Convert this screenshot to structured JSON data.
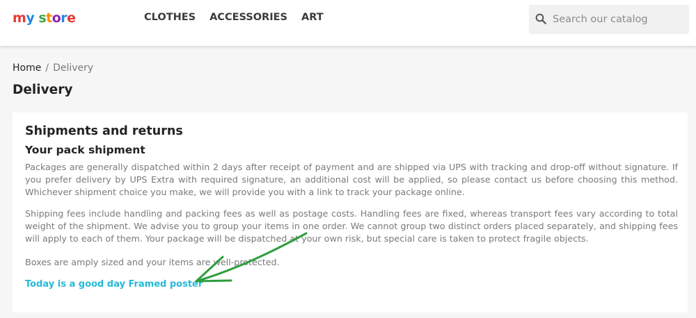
{
  "header": {
    "logo": {
      "parts": [
        {
          "text": "m",
          "color": "#e53935"
        },
        {
          "text": "y",
          "color": "#1e88e5"
        },
        {
          "text": " ",
          "color": "#000000"
        },
        {
          "text": "s",
          "color": "#43a047"
        },
        {
          "text": "t",
          "color": "#fb8c00"
        },
        {
          "text": "o",
          "color": "#8e24aa"
        },
        {
          "text": "r",
          "color": "#1e88e5"
        },
        {
          "text": "e",
          "color": "#e53935"
        }
      ],
      "full_text": "my store"
    },
    "nav": [
      "CLOTHES",
      "ACCESSORIES",
      "ART"
    ],
    "search": {
      "placeholder": "Search our catalog",
      "icon": "search-icon"
    }
  },
  "breadcrumb": {
    "home": "Home",
    "separator": "/",
    "current": "Delivery"
  },
  "page_title": "Delivery",
  "content": {
    "heading": "Shipments and returns",
    "subheading": "Your pack shipment",
    "paragraphs": [
      "Packages are generally dispatched within 2 days after receipt of payment and are shipped via UPS with tracking and drop-off without signature. If you prefer delivery by UPS Extra with required signature, an additional cost will be applied, so please contact us before choosing this method. Whichever shipment choice you make, we will provide you with a link to track your package online.",
      "Shipping fees include handling and packing fees as well as postage costs. Handling fees are fixed, whereas transport fees vary according to total weight of the shipment. We advise you to group your items in one order. We cannot group two distinct orders placed separately, and shipping fees will apply to each of them. Your package will be dispatched at your own risk, but special care is taken to protect fragile objects.",
      "Boxes are amply sized and your items are well-protected."
    ],
    "product_link": "Today is a good day Framed poster"
  },
  "colors": {
    "accent": "#24b9d7",
    "annotation_arrow": "#2e9e3e"
  }
}
